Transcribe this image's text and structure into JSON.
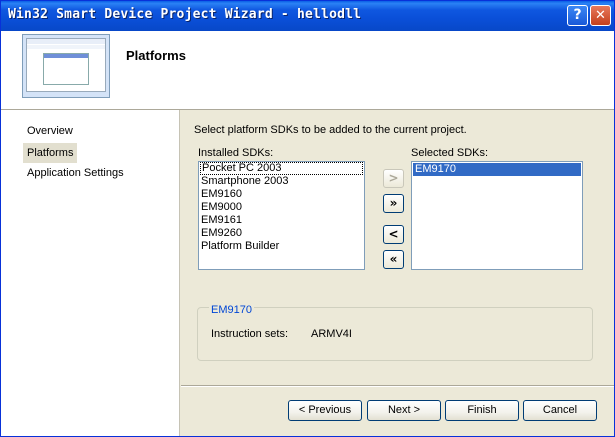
{
  "window": {
    "title": "Win32 Smart Device Project Wizard - hellodll"
  },
  "titlebar": {
    "help_glyph": "?",
    "close_glyph": "✕"
  },
  "header": {
    "title": "Platforms"
  },
  "sidebar": {
    "items": [
      {
        "label": "Overview",
        "selected": false
      },
      {
        "label": "Platforms",
        "selected": true
      },
      {
        "label": "Application Settings",
        "selected": false
      }
    ]
  },
  "main": {
    "instruction": "Select platform SDKs to be added to the current project.",
    "installed_label": "Installed SDKs:",
    "installed_items": [
      "Pocket PC 2003",
      "Smartphone 2003",
      "EM9160",
      "EM9000",
      "EM9161",
      "EM9260",
      "Platform Builder"
    ],
    "selected_label": "Selected SDKs:",
    "selected_items": [
      "EM9170"
    ],
    "move_buttons": {
      "add": ">",
      "add_all": "»",
      "remove": "<",
      "remove_all": "«"
    },
    "group": {
      "title": "EM9170",
      "instruction_sets_label": "Instruction sets:",
      "instruction_sets_value": "ARMV4I"
    }
  },
  "footer": {
    "previous": "< Previous",
    "next": "Next >",
    "finish": "Finish",
    "cancel": "Cancel"
  },
  "colors": {
    "titlebar": "#0a4fd8",
    "selection": "#316ac5",
    "dialog_bg": "#ece9d8",
    "group_title": "#0046d5"
  }
}
